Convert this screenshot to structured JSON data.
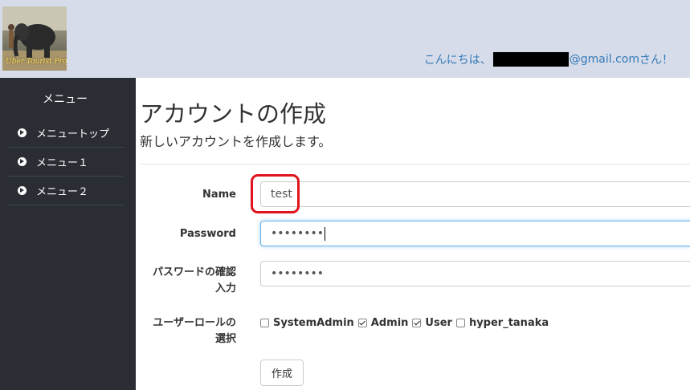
{
  "header": {
    "logo_text": "Uber Tourist Project",
    "greeting_prefix": "こんにちは、",
    "greeting_email_suffix": "@gmail.com",
    "greeting_suffix": " さん！"
  },
  "sidebar": {
    "title": "メニュー",
    "items": [
      {
        "label": "メニュートップ"
      },
      {
        "label": "メニュー１"
      },
      {
        "label": "メニュー２"
      }
    ]
  },
  "main": {
    "title": "アカウントの作成",
    "subtitle": "新しいアカウントを作成します。",
    "form": {
      "name_label": "Name",
      "name_value": "test",
      "password_label": "Password",
      "password_value": "••••••••",
      "confirm_label_line1": "パスワードの確認",
      "confirm_label_line2": "入力",
      "confirm_value": "••••••••",
      "roles_label_line1": "ユーザーロールの",
      "roles_label_line2": "選択",
      "roles": [
        {
          "label": "SystemAdmin",
          "checked": false
        },
        {
          "label": "Admin",
          "checked": true
        },
        {
          "label": "User",
          "checked": true
        },
        {
          "label": "hyper_tanaka",
          "checked": false
        }
      ],
      "submit_label": "作成"
    }
  },
  "colors": {
    "header_bg": "#d6dce9",
    "sidebar_bg": "#2a2e34",
    "link": "#337ab7",
    "highlight": "#e0141e"
  }
}
